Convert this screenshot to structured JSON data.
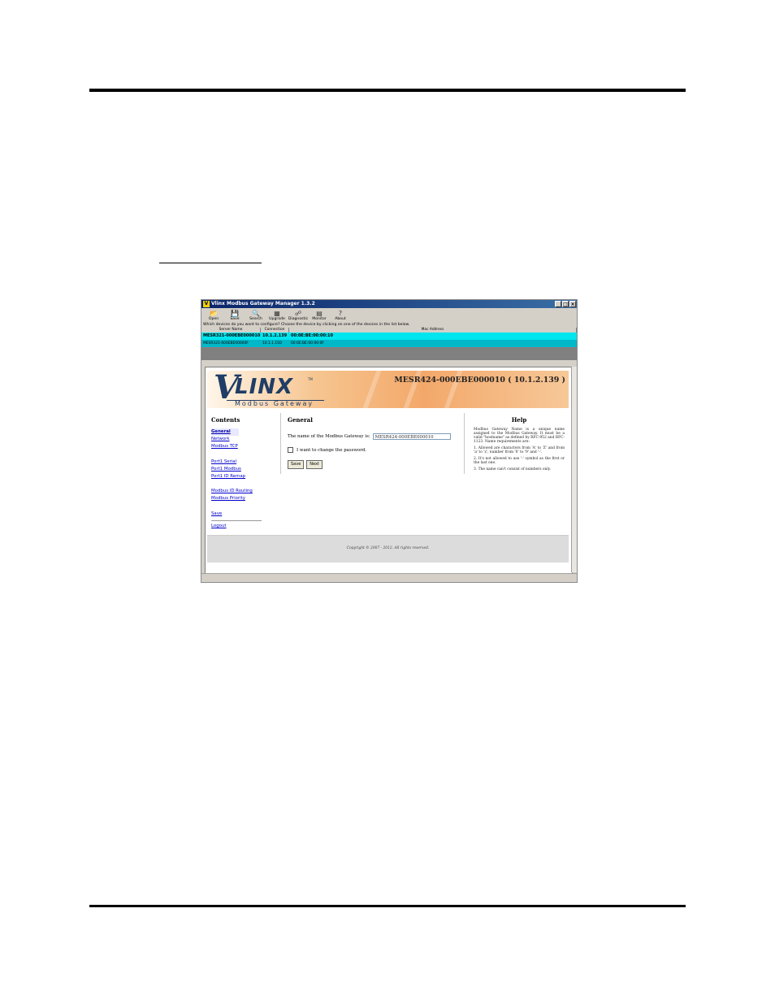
{
  "app": {
    "title": "Vlinx Modbus Gateway Manager 1.3.2",
    "prompt": "Which devices do you want to configure? Choose the device by clicking on one of the devices in the list below.",
    "toolbar": [
      {
        "label": "Open",
        "icon": "open-folder-icon",
        "glyph": "📂"
      },
      {
        "label": "Save",
        "icon": "save-disk-icon",
        "glyph": "💾"
      },
      {
        "label": "Search",
        "icon": "search-icon",
        "glyph": "🔍"
      },
      {
        "label": "Upgrade",
        "icon": "upgrade-icon",
        "glyph": "▦"
      },
      {
        "label": "Diagnostic",
        "icon": "diagnostic-icon",
        "glyph": "☍"
      },
      {
        "label": "Monitor",
        "icon": "monitor-icon",
        "glyph": "▤"
      },
      {
        "label": "About",
        "icon": "help-icon",
        "glyph": "?"
      }
    ],
    "device_columns": [
      "Server Name",
      "Connection",
      "Mac Address"
    ],
    "devices": [
      {
        "name": "MESR321-000EBE000010",
        "connection": "10.1.2.139",
        "mac": "00:0E:BE:00:00:10"
      },
      {
        "name": "MESR321-000EBE00000F",
        "connection": "10.1.1.150",
        "mac": "00:0E:BE:00:00:0F"
      }
    ]
  },
  "page": {
    "device_title": "MESR424-000EBE000010 ( 10.1.2.139 )",
    "logo_sub": "Modbus Gateway",
    "logo_tm": "TM",
    "contents_title": "Contents",
    "nav": {
      "general": "General",
      "network": "Network",
      "modbus_tcp": "Modbus TCP",
      "port1_serial": "Port1 Serial",
      "port1_modbus": "Port1 Modbus",
      "port1_id_remap": "Port1 ID Remap",
      "modbus_id_routing": "Modbus ID Routing",
      "modbus_priority": "Modbus Priority",
      "save": "Save",
      "logout": "Logout"
    },
    "general_title": "General",
    "name_label": "The name of the Modbus Gateway is:",
    "name_value": "MESR424-000EBE000010",
    "password_label": "I want to change the password.",
    "save_btn": "Save",
    "next_btn": "Next",
    "help_title": "Help",
    "help": [
      "Modbus Gateway Name is a unique name assigned to the Modbus Gateway. It must be a valid \"hostname\" as defined by RFC-952 and RFC-1123. Name requirements are:",
      "1. Allowed are characters from 'A' to 'Z' and from 'a' to 'z', number from '0' to '9' and '-'.",
      "2. It's not allowed to use '-' symbol as the first or the last one.",
      "3. The name can't consist of numbers only."
    ],
    "copyright": "Copyright © 2007 - 2012. All rights reserved."
  }
}
